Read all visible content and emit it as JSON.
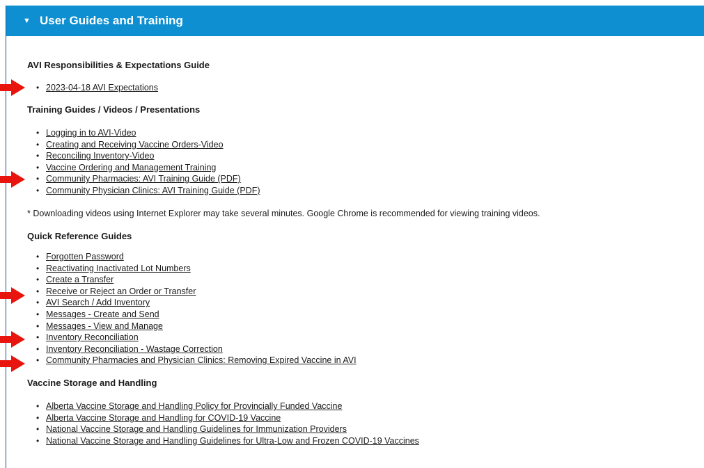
{
  "panel": {
    "title": "User Guides and Training",
    "caret_icon": "▼"
  },
  "sections": {
    "avi": {
      "title": "AVI Responsibilities & Expectations Guide",
      "links": [
        "2023-04-18 AVI Expectations"
      ]
    },
    "training": {
      "title": "Training Guides / Videos / Presentations",
      "links": [
        "Logging in to AVI-Video",
        "Creating and Receiving Vaccine Orders-Video",
        "Reconciling Inventory-Video",
        "Vaccine Ordering and Management Training",
        "Community Pharmacies: AVI Training Guide (PDF)",
        "Community Physician Clinics: AVI Training Guide (PDF)"
      ],
      "note": "* Downloading videos using Internet Explorer may take several minutes. Google Chrome is recommended for viewing training videos."
    },
    "quick": {
      "title": "Quick Reference Guides",
      "links": [
        "Forgotten Password",
        "Reactivating Inactivated Lot Numbers",
        "Create a Transfer",
        "Receive or Reject an Order or Transfer",
        "AVI Search / Add Inventory",
        "Messages - Create and Send",
        "Messages - View and Manage",
        "Inventory Reconciliation",
        "Inventory Reconciliation - Wastage Correction",
        "Community Pharmacies and Physician Clinics: Removing Expired Vaccine in AVI"
      ]
    },
    "storage": {
      "title": "Vaccine Storage and Handling",
      "links": [
        "Alberta Vaccine Storage and Handling Policy for Provincially Funded Vaccine",
        "Alberta Vaccine Storage and Handling for COVID-19 Vaccine",
        "National Vaccine Storage and Handling Guidelines for Immunization Providers",
        "National Vaccine Storage and Handling Guidelines for Ultra-Low and Frozen COVID-19 Vaccines"
      ]
    }
  },
  "annotations": {
    "arrow_color": "#e8150e",
    "arrow_icon": "red-right-arrow-icon"
  },
  "colors": {
    "header_bg": "#0d8fd1",
    "header_text": "#ffffff"
  }
}
